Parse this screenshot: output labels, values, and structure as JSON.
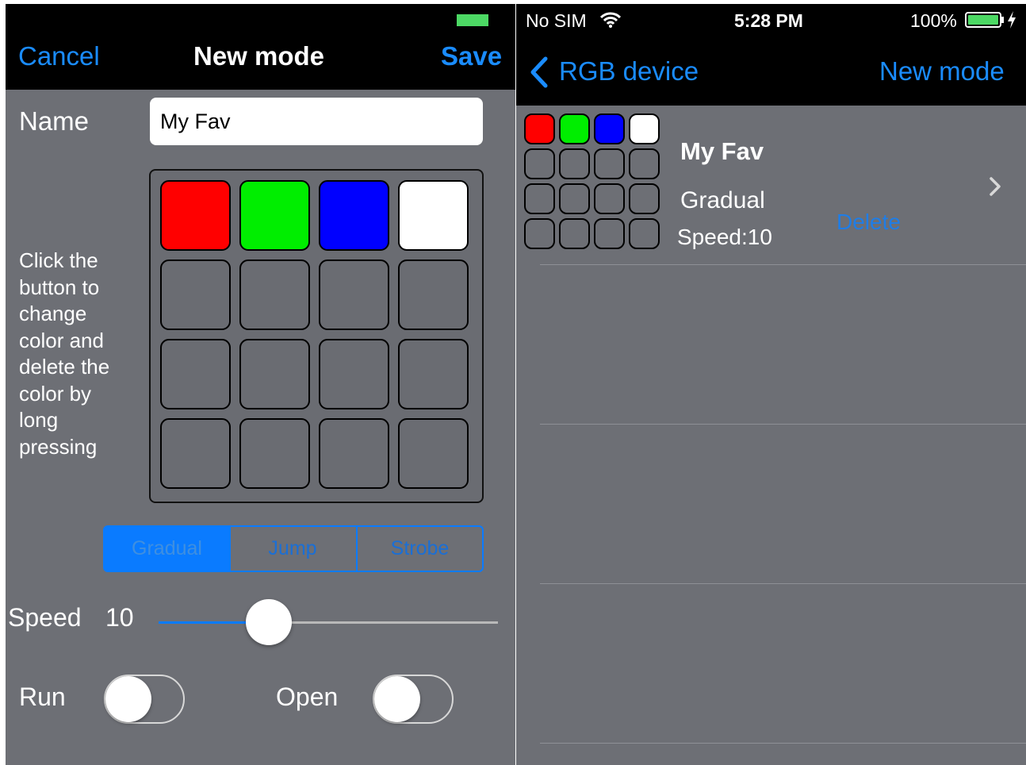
{
  "left": {
    "nav": {
      "cancel": "Cancel",
      "title": "New mode",
      "save": "Save"
    },
    "name_label": "Name",
    "name_value": "My Fav",
    "instructions": [
      "Click the",
      "button to",
      "change",
      "color and",
      "delete the",
      "color by",
      "long",
      "pressing"
    ],
    "grid_colors": [
      "#ff0000",
      "#00ee00",
      "#0000ff",
      "#ffffff"
    ],
    "modes": {
      "gradual": "Gradual",
      "jump": "Jump",
      "strobe": "Strobe",
      "selected": "Gradual"
    },
    "speed_label": "Speed",
    "speed_value": "10",
    "speed_fraction": 0.31,
    "run_label": "Run",
    "open_label": "Open",
    "run_on": false,
    "open_on": false
  },
  "right": {
    "status": {
      "carrier": "No SIM",
      "time": "5:28 PM",
      "battery": "100%"
    },
    "nav": {
      "back": "RGB device",
      "action": "New mode"
    },
    "item": {
      "name": "My Fav",
      "mode": "Gradual",
      "speed": "Speed:10",
      "delete": "Delete"
    }
  },
  "colors": {
    "accent": "#1a8cff",
    "background": "#6d6f75",
    "navbar": "#000000"
  },
  "icons": [
    "battery-icon",
    "wifi-icon",
    "back-chevron-icon",
    "disclosure-chevron-icon",
    "charging-bolt-icon"
  ]
}
